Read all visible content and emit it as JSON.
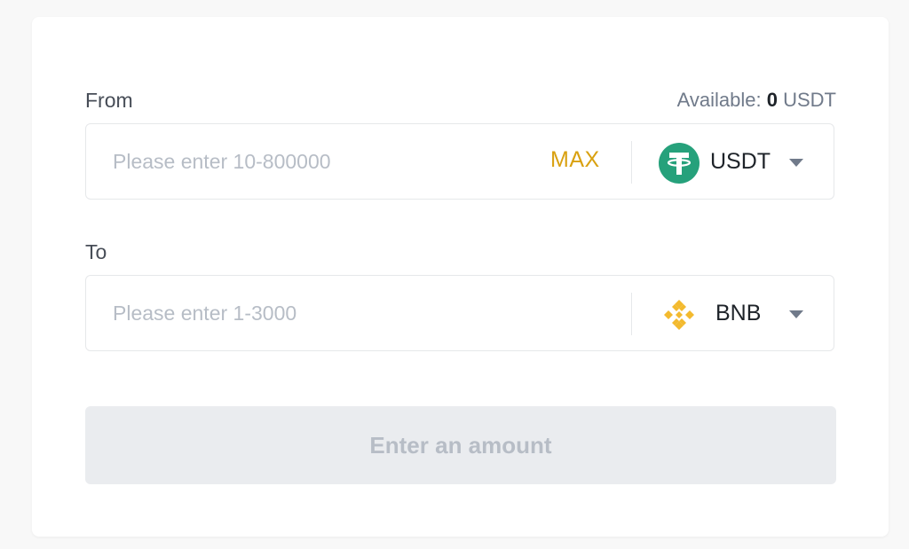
{
  "from": {
    "label": "From",
    "available_label": "Available:",
    "available_amount": "0",
    "available_unit": "USDT",
    "placeholder": "Please enter 10-800000",
    "max_label": "MAX",
    "coin": {
      "symbol": "USDT",
      "icon": "tether-icon",
      "color": "#26a17b"
    }
  },
  "to": {
    "label": "To",
    "placeholder": "Please enter 1-3000",
    "coin": {
      "symbol": "BNB",
      "icon": "bnb-icon",
      "color": "#f3ba2f"
    }
  },
  "submit": {
    "label": "Enter an amount"
  },
  "colors": {
    "accent": "#d9a111",
    "disabled_bg": "#eaecef",
    "disabled_text": "#b7bdc6"
  }
}
